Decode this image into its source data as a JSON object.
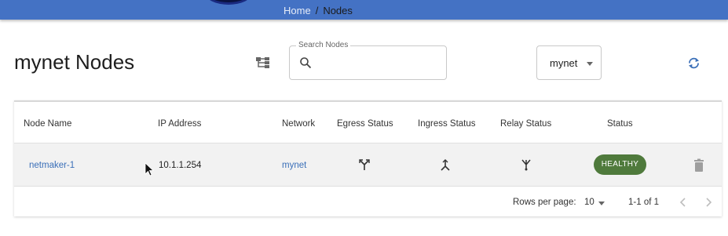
{
  "breadcrumb": {
    "home": "Home",
    "separator": "/",
    "current": "Nodes"
  },
  "page": {
    "title": "mynet Nodes"
  },
  "search": {
    "label": "Search Nodes",
    "value": "",
    "placeholder": ""
  },
  "network_select": {
    "value": "mynet"
  },
  "table": {
    "headers": [
      "Node Name",
      "IP Address",
      "Network",
      "Egress Status",
      "Ingress Status",
      "Relay Status",
      "Status"
    ],
    "rows": [
      {
        "node_name": "netmaker-1",
        "ip_address": "10.1.1.254",
        "network": "mynet",
        "egress_icon": "egress-fork-icon",
        "ingress_icon": "ingress-merge-icon",
        "relay_icon": "relay-icon",
        "status": "HEALTHY"
      }
    ]
  },
  "pagination": {
    "rows_per_page_label": "Rows per page:",
    "rows_per_page": "10",
    "range": "1-1 of 1"
  },
  "colors": {
    "header_bar": "#4472c4",
    "accent": "#3a6fb8",
    "healthy": "#4f7a3c"
  }
}
